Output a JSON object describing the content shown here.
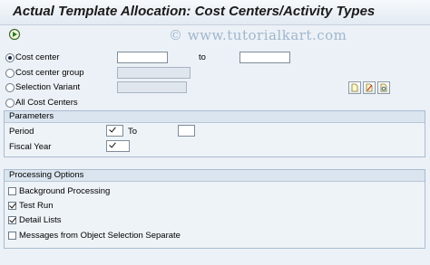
{
  "window": {
    "title": "Actual Template Allocation: Cost Centers/Activity Types"
  },
  "toolbar": {
    "execute_icon": "execute-icon"
  },
  "watermark": "© www.tutorialkart.com",
  "selection": {
    "cost_center_label": "Cost center",
    "to_label": "to",
    "cost_center_from": "",
    "cost_center_to": "",
    "cost_center_group_label": "Cost center group",
    "cost_center_group_value": "",
    "selection_variant_label": "Selection Variant",
    "selection_variant_value": "",
    "all_cost_centers_label": "All Cost Centers",
    "selected": "cost_center"
  },
  "variant_buttons": [
    "create-icon",
    "change-icon",
    "display-icon"
  ],
  "parameters": {
    "title": "Parameters",
    "period_label": "Period",
    "period_to_label": "To",
    "period_value": "",
    "period_to_value": "",
    "fiscal_year_label": "Fiscal Year",
    "fiscal_year_value": ""
  },
  "processing": {
    "title": "Processing Options",
    "options": [
      {
        "label": "Background Processing",
        "checked": false
      },
      {
        "label": "Test Run",
        "checked": true
      },
      {
        "label": "Detail Lists",
        "checked": true
      },
      {
        "label": "Messages from Object Selection Separate",
        "checked": false
      }
    ]
  },
  "colors": {
    "background": "#ecf1f7",
    "group_header": "#dbe5ef",
    "input_border": "#7f8c99"
  }
}
